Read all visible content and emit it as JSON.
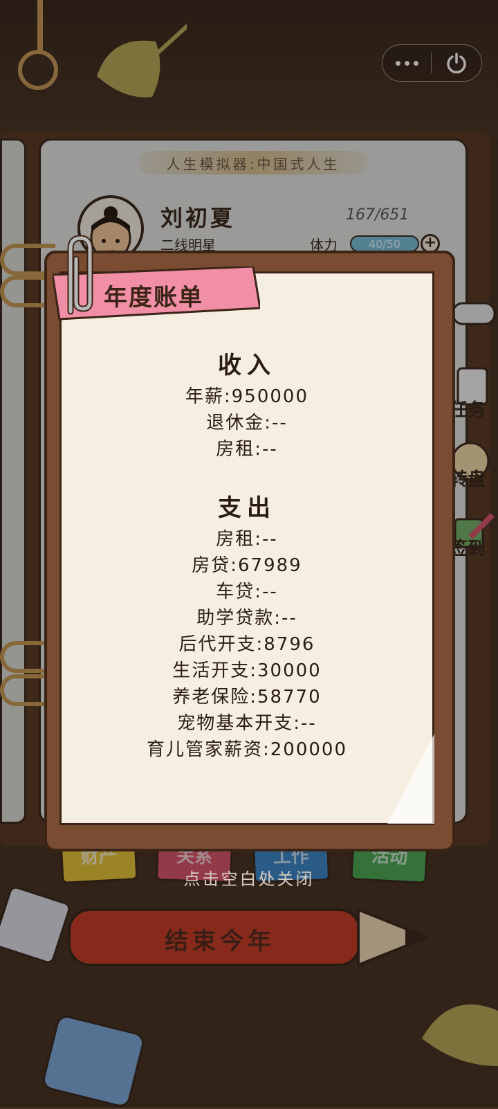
{
  "game": {
    "title": "人生模拟器:中国式人生",
    "character_name": "刘初夏",
    "character_role": "二线明星",
    "coins": "167/651",
    "stamina_label": "体力",
    "stamina_value": "40/50",
    "stamina_plus": "+"
  },
  "side_menu": [
    {
      "label": "任务",
      "icon": "clipboard-icon"
    },
    {
      "label": "转盘",
      "icon": "wheel-icon"
    },
    {
      "label": "签到",
      "icon": "pencil-icon"
    }
  ],
  "bottom_tabs": [
    {
      "label": "财产",
      "color": "#e5c23a"
    },
    {
      "label": "关系",
      "color": "#d9566b"
    },
    {
      "label": "工作",
      "color": "#3f86c8"
    },
    {
      "label": "活动",
      "color": "#4fa856"
    }
  ],
  "end_year_button": "结束今年",
  "close_hint": "点击空白处关闭",
  "capsule": {
    "more_icon": "more-dots-icon",
    "power_icon": "power-icon"
  },
  "modal": {
    "title": "年度账单",
    "income": {
      "heading": "收入",
      "items": [
        "年薪:950000",
        "退休金:--",
        "房租:--"
      ]
    },
    "expense": {
      "heading": "支出",
      "items": [
        "房租:--",
        "房贷:67989",
        "车贷:--",
        "助学贷款:--",
        "后代开支:8796",
        "生活开支:30000",
        "养老保险:58770",
        "宠物基本开支:--",
        "育儿管家薪资:200000"
      ]
    }
  },
  "colors": {
    "ribbon": "#f08fa6",
    "paper": "#f5eee1",
    "board": "#7a4d33"
  }
}
